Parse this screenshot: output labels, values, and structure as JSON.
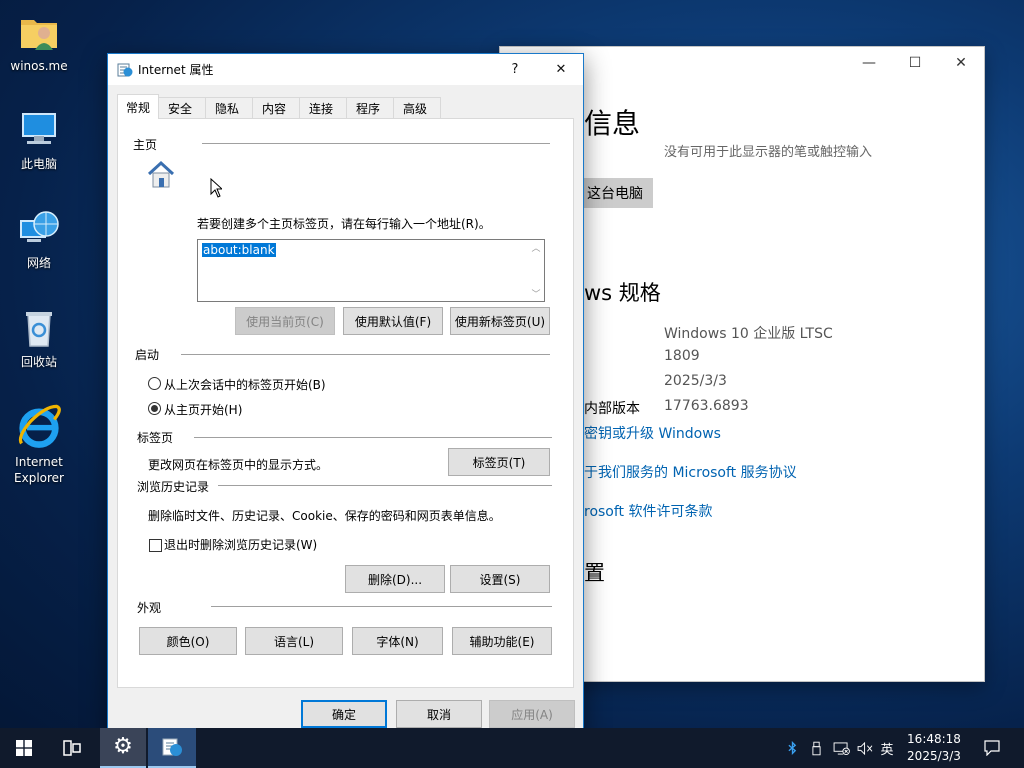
{
  "desktop": {
    "icons": [
      {
        "label": "winos.me"
      },
      {
        "label": "此电脑"
      },
      {
        "label": "网络"
      },
      {
        "label": "回收站"
      },
      {
        "label": "Internet Explorer"
      }
    ]
  },
  "settings_window": {
    "heading": "信息",
    "pen_touch_note": "没有可用于此显示器的笔或触控输入",
    "rename_button": "这台电脑",
    "specs_heading": "ws 规格",
    "edition_value": "Windows 10 企业版 LTSC",
    "version_value": "1809",
    "install_date_value": "2025/3/3",
    "build_label": "内部版本",
    "build_value": "17763.6893",
    "link_product_key": "密钥或升级 Windows",
    "link_services": "于我们服务的 Microsoft 服务协议",
    "link_license": "rosoft 软件许可条款",
    "settings_heading": "置"
  },
  "dialog": {
    "title": "Internet 属性",
    "help_glyph": "?",
    "close_glyph": "✕",
    "tabs": [
      {
        "label": "常规",
        "active": true
      },
      {
        "label": "安全",
        "active": false
      },
      {
        "label": "隐私",
        "active": false
      },
      {
        "label": "内容",
        "active": false
      },
      {
        "label": "连接",
        "active": false
      },
      {
        "label": "程序",
        "active": false
      },
      {
        "label": "高级",
        "active": false
      }
    ],
    "home": {
      "group": "主页",
      "instruction": "若要创建多个主页标签页，请在每行输入一个地址(R)。",
      "url": "about:blank",
      "btn_current": "使用当前页(C)",
      "btn_default": "使用默认值(F)",
      "btn_newtab": "使用新标签页(U)"
    },
    "startup": {
      "group": "启动",
      "option_last": "从上次会话中的标签页开始(B)",
      "option_home": "从主页开始(H)",
      "selected": "option_home"
    },
    "tabs_group": {
      "group": "标签页",
      "desc": "更改网页在标签页中的显示方式。",
      "button": "标签页(T)"
    },
    "history": {
      "group": "浏览历史记录",
      "desc": "删除临时文件、历史记录、Cookie、保存的密码和网页表单信息。",
      "checkbox": "退出时删除浏览历史记录(W)",
      "checked": false,
      "btn_delete": "删除(D)...",
      "btn_settings": "设置(S)"
    },
    "appearance": {
      "group": "外观",
      "btn_colors": "颜色(O)",
      "btn_languages": "语言(L)",
      "btn_fonts": "字体(N)",
      "btn_accessibility": "辅助功能(E)"
    },
    "footer": {
      "ok": "确定",
      "cancel": "取消",
      "apply": "应用(A)"
    }
  },
  "taskbar": {
    "ime": "英",
    "time": "16:48:18",
    "date": "2025/3/3"
  },
  "colors": {
    "accent": "#0078d7",
    "link": "#0063b1",
    "selection": "#0078d7"
  }
}
